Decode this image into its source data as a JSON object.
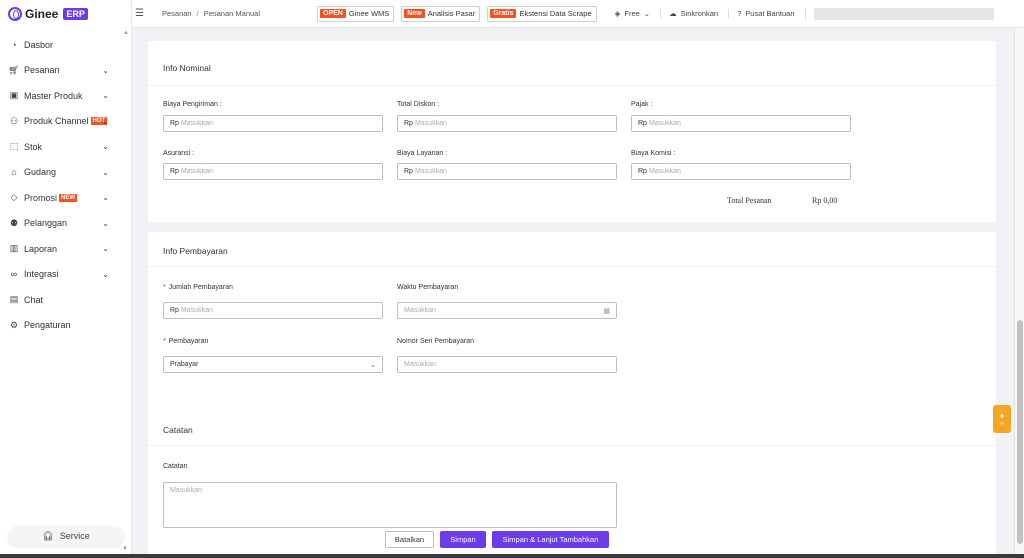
{
  "app": {
    "logo_text": "Ginee",
    "logo_badge": "ERP",
    "accent_color": "#6a3de8"
  },
  "sidebar": {
    "items": [
      {
        "label": "Dasbor",
        "icon": "dashboard-icon",
        "chevron": false,
        "tag": ""
      },
      {
        "label": "Pesanan",
        "icon": "cart-icon",
        "chevron": true,
        "tag": ""
      },
      {
        "label": "Master Produk",
        "icon": "bag-icon",
        "chevron": true,
        "tag": ""
      },
      {
        "label": "Produk Channel",
        "icon": "channel-icon",
        "chevron": true,
        "tag": "HOT"
      },
      {
        "label": "Stok",
        "icon": "box-icon",
        "chevron": true,
        "tag": ""
      },
      {
        "label": "Gudang",
        "icon": "warehouse-icon",
        "chevron": true,
        "tag": ""
      },
      {
        "label": "Promosi",
        "icon": "tag-icon",
        "chevron": true,
        "tag": "NEW"
      },
      {
        "label": "Pelanggan",
        "icon": "users-icon",
        "chevron": true,
        "tag": ""
      },
      {
        "label": "Laporan",
        "icon": "report-icon",
        "chevron": true,
        "tag": ""
      },
      {
        "label": "Integrasi",
        "icon": "link-icon",
        "chevron": true,
        "tag": ""
      },
      {
        "label": "Chat",
        "icon": "chat-icon",
        "chevron": false,
        "tag": ""
      },
      {
        "label": "Pengaturan",
        "icon": "gear-icon",
        "chevron": false,
        "tag": ""
      }
    ],
    "service_label": "Service"
  },
  "header": {
    "breadcrumb": [
      "Pesanan",
      "Pesanan Manual"
    ],
    "wms": {
      "tag": "OPEN",
      "label": "Ginee WMS"
    },
    "market": {
      "tag": "New",
      "label": "Analisis Pasar"
    },
    "scrape": {
      "tag": "Gratis",
      "label": "Ekstensi Data Scrape"
    },
    "plan_label": "Free",
    "sync_label": "Sinkronkan",
    "help_label": "Pusat Bantuan"
  },
  "info_nominal": {
    "title": "Info Nominal",
    "currency_prefix": "Rp",
    "placeholder": "Masukkan",
    "fields": [
      {
        "label": "Biaya Pengiriman :"
      },
      {
        "label": "Total Diskon :"
      },
      {
        "label": "Pajak :"
      },
      {
        "label": "Asuransi :"
      },
      {
        "label": "Biaya Layanan :"
      },
      {
        "label": "Biaya Komisi :"
      }
    ],
    "total_label": "Total Pesanan",
    "total_value": "Rp 0,00"
  },
  "info_pembayaran": {
    "title": "Info Pembayaran",
    "amount_label": "Jumlah Pembayaran",
    "amount_placeholder": "Masukkan",
    "time_label": "Waktu Pembayaran",
    "time_placeholder": "Masukkan",
    "method_label": "Pembayaran",
    "method_value": "Prabayar",
    "serial_label": "Nomor Seri Pembayaran",
    "serial_placeholder": "Masukkan"
  },
  "catatan": {
    "title": "Catatan",
    "field_label": "Catatan",
    "placeholder": "Masukkan"
  },
  "footer": {
    "cancel_label": "Batalkan",
    "save_label": "Simpan",
    "save_next_label": "Simpan & Lanjut Tambahkan"
  }
}
